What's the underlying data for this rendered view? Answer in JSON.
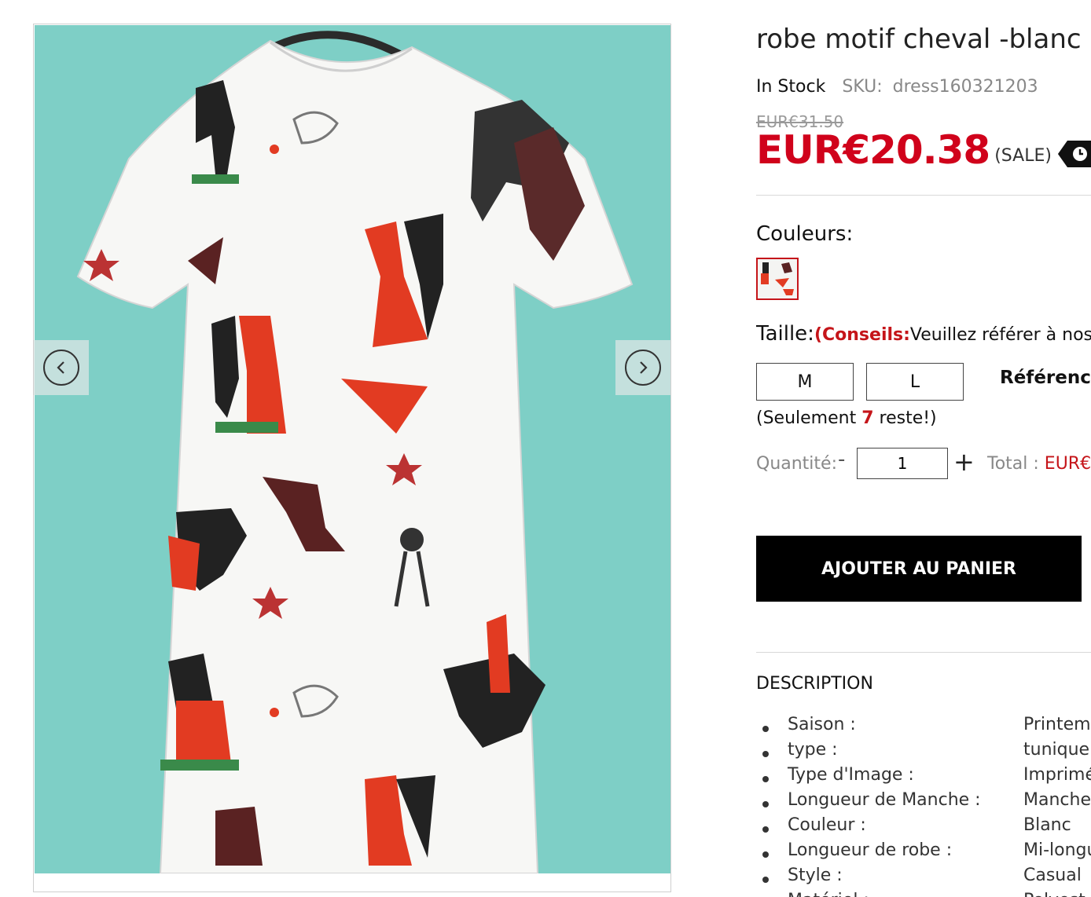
{
  "product": {
    "title": "robe motif cheval -blanc",
    "stock_status": "In Stock",
    "sku_label": "SKU:",
    "sku_value": "dress160321203",
    "old_price": "EUR€31.50",
    "price": "EUR€20.38",
    "sale_label": "(SALE)"
  },
  "colors": {
    "label": "Couleurs:"
  },
  "size": {
    "label": "Taille:",
    "tips_prefix": "(",
    "tips_label": "Conseils:",
    "tips_text": "Veuillez référer à nos r",
    "options": [
      "M",
      "L"
    ],
    "reference_label": "Référence"
  },
  "stock_left": {
    "prefix": "(Seulement ",
    "count": "7",
    "suffix": " reste!)"
  },
  "quantity": {
    "label": "Quantité:",
    "minus": "-",
    "value": "1",
    "plus": "+",
    "total_label": "Total :",
    "total_value": "EUR€"
  },
  "cart_button": "AJOUTER AU PANIER",
  "description": {
    "title": "DESCRIPTION",
    "specs": [
      {
        "key": "Saison :",
        "value": "Printemp"
      },
      {
        "key": "type :",
        "value": "tunique"
      },
      {
        "key": "Type d'Image :",
        "value": "Imprimé"
      },
      {
        "key": "Longueur de Manche :",
        "value": "Manche"
      },
      {
        "key": "Couleur :",
        "value": "Blanc"
      },
      {
        "key": "Longueur de robe :",
        "value": "Mi-longu"
      },
      {
        "key": "Style :",
        "value": "Casual"
      },
      {
        "key": "Matériel :",
        "value": "Polyest"
      }
    ]
  },
  "theme": {
    "accent": "#d0021b",
    "button_bg": "#000000",
    "photo_bg": "#7ecfc6"
  }
}
